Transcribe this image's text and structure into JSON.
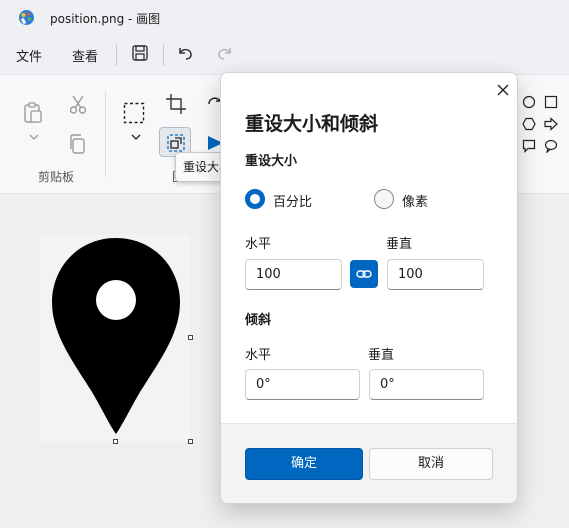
{
  "window": {
    "title": "position.png - 画图"
  },
  "menu": {
    "file": "文件",
    "view": "查看"
  },
  "ribbon": {
    "clipboard_group": "剪贴板",
    "image_group": "图"
  },
  "tooltip": {
    "text": "重设大小"
  },
  "dialog": {
    "title": "重设大小和倾斜",
    "resize_section": "重设大小",
    "radio_percent": "百分比",
    "radio_pixels": "像素",
    "resize_horizontal_label": "水平",
    "resize_vertical_label": "垂直",
    "resize_horizontal_value": "100",
    "resize_vertical_value": "100",
    "skew_section": "倾斜",
    "skew_horizontal_label": "水平",
    "skew_vertical_label": "垂直",
    "skew_horizontal_value": "0°",
    "skew_vertical_value": "0°",
    "ok_label": "确定",
    "cancel_label": "取消"
  },
  "colors": {
    "accent": "#0067c0"
  }
}
